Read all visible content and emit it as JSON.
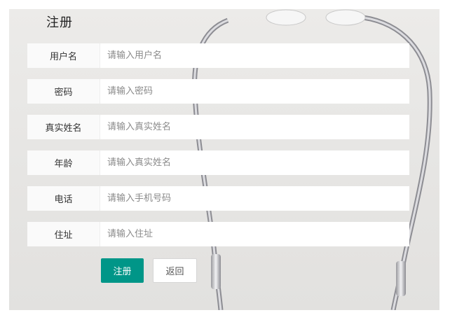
{
  "form": {
    "title": "注册",
    "fields": [
      {
        "label": "用户名",
        "placeholder": "请输入用户名",
        "value": ""
      },
      {
        "label": "密码",
        "placeholder": "请输入密码",
        "value": ""
      },
      {
        "label": "真实姓名",
        "placeholder": "请输入真实姓名",
        "value": ""
      },
      {
        "label": "年龄",
        "placeholder": "请输入真实姓名",
        "value": ""
      },
      {
        "label": "电话",
        "placeholder": "请输入手机号码",
        "value": ""
      },
      {
        "label": "住址",
        "placeholder": "请输入住址",
        "value": ""
      }
    ],
    "submit_label": "注册",
    "back_label": "返回"
  },
  "colors": {
    "primary": "#009688",
    "background": "#e8e7e5",
    "label_bg": "#fafafa"
  }
}
